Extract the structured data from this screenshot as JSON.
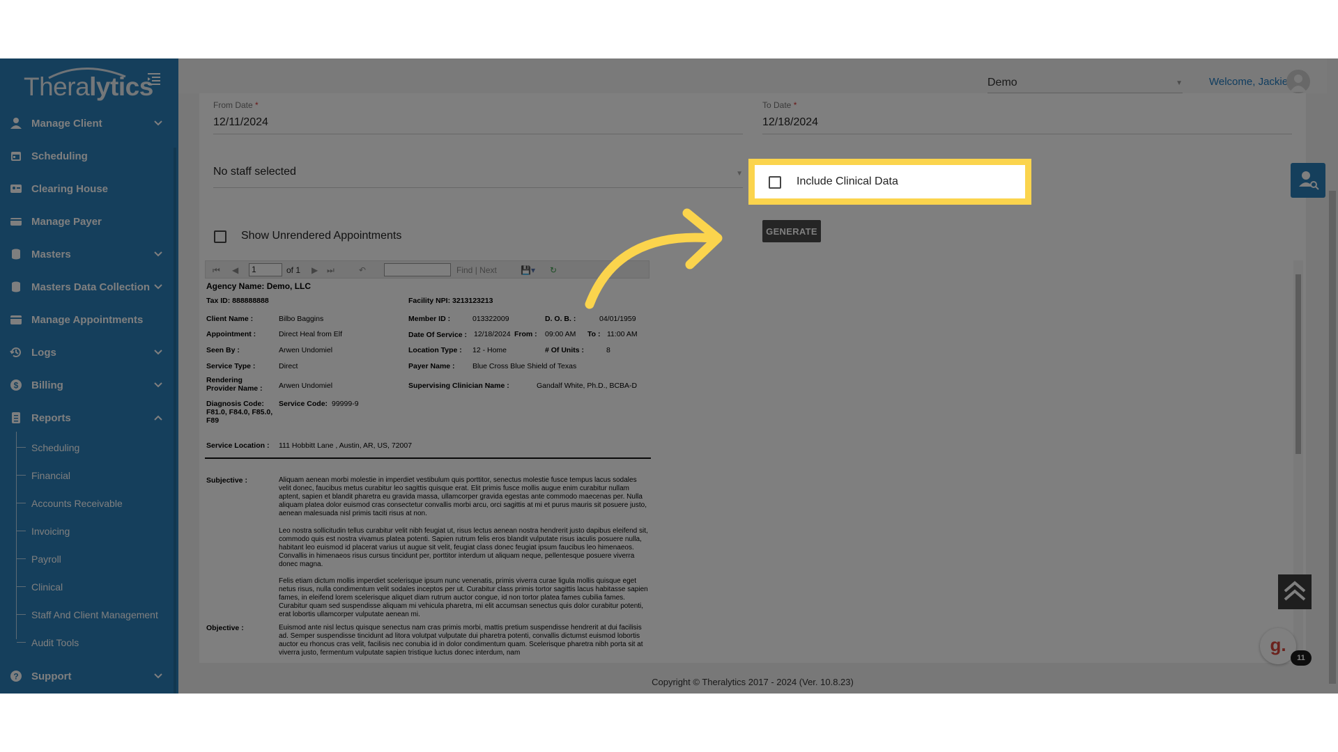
{
  "app": {
    "logo_text_light": "Thera",
    "logo_text_bold": "lytics",
    "welcome": "Welcome, Jackie",
    "organization": "Demo",
    "accent_color": "#2a7fb8",
    "highlight_color": "#fbd44d"
  },
  "sidebar": {
    "items": [
      {
        "label": "Manage Client",
        "icon": "user-icon",
        "has_chevron": true
      },
      {
        "label": "Scheduling",
        "icon": "calendar-icon",
        "has_chevron": false
      },
      {
        "label": "Clearing House",
        "icon": "id-card-icon",
        "has_chevron": false
      },
      {
        "label": "Manage Payer",
        "icon": "wallet-icon",
        "has_chevron": false
      },
      {
        "label": "Masters",
        "icon": "database-icon",
        "has_chevron": true
      },
      {
        "label": "Masters Data Collection",
        "icon": "database-icon",
        "has_chevron": true
      },
      {
        "label": "Manage Appointments",
        "icon": "calendar-alt-icon",
        "has_chevron": false
      },
      {
        "label": "Logs",
        "icon": "history-icon",
        "has_chevron": true
      },
      {
        "label": "Billing",
        "icon": "dollar-icon",
        "has_chevron": true
      },
      {
        "label": "Reports",
        "icon": "report-icon",
        "has_chevron": true,
        "expanded": true
      }
    ],
    "report_subitems": [
      "Scheduling",
      "Financial",
      "Accounts Receivable",
      "Invoicing",
      "Payroll",
      "Clinical",
      "Staff And Client Management",
      "Audit Tools"
    ],
    "support": {
      "label": "Support",
      "icon": "question-icon"
    }
  },
  "form": {
    "from_date_label": "From Date",
    "from_date_value": "12/11/2024",
    "to_date_label": "To Date",
    "to_date_value": "12/18/2024",
    "required_mark": "*",
    "staff_select_value": "No staff selected",
    "show_unrendered_label": "Show Unrendered Appointments",
    "include_clinical_label": "Include Clinical Data",
    "generate_label": "GENERATE"
  },
  "viewer": {
    "page_value": "1",
    "page_of": "of 1",
    "find_label": "Find",
    "separator": "|",
    "next_label": "Next"
  },
  "report": {
    "agency": "Agency Name: Demo, LLC",
    "tax_id": "Tax ID: 888888888",
    "facility_npi": "Facility NPI: 3213123213",
    "client_name_label": "Client Name :",
    "client_name": "Bilbo Baggins",
    "member_id_label": "Member ID :",
    "member_id": "013322009",
    "dob_label": "D. O. B. :",
    "dob": "04/01/1959",
    "appointment_label": "Appointment :",
    "appointment": "Direct Heal from Elf",
    "dos_label": "Date Of Service :",
    "dos": "12/18/2024",
    "from_label": "From :",
    "from": "09:00 AM",
    "to_label": "To :",
    "to": "11:00 AM",
    "seen_by_label": "Seen By :",
    "seen_by": "Arwen Undomiel",
    "location_type_label": "Location Type :",
    "location_type": "12 - Home",
    "units_label": "# Of Units :",
    "units": "8",
    "service_type_label": "Service Type :",
    "service_type": "Direct",
    "payer_label": "Payer Name :",
    "payer": "Blue Cross Blue Shield of Texas",
    "rendering_label_1": "Rendering",
    "rendering_label_2": "Provider Name :",
    "rendering": "Arwen Undomiel",
    "supervising_label": "Supervising Clinician Name :",
    "supervising": "Gandalf White, Ph.D., BCBA-D",
    "diagnosis_label": "Diagnosis Code:",
    "diagnosis_1": "F81.0, F84.0, F85.0,",
    "diagnosis_2": "F89",
    "service_code_label": "Service Code:",
    "service_code": "99999-9",
    "service_location_label": "Service Location :",
    "service_location": "111 Hobbitt Lane , Austin, AR, US, 72007",
    "subjective_label": "Subjective :",
    "subjective_p1": "Aliquam aenean morbi molestie in imperdiet vestibulum quis porttitor, senectus molestie fusce tempus lacus sodales velit donec, faucibus metus curabitur leo sagittis quisque erat. Elit primis fusce mollis augue enim curabitur nullam aptent, sapien et blandit pharetra eu gravida massa, ullamcorper gravida egestas ante commodo maecenas per. Nulla aliquam platea dolor euismod cras consectetur convallis morbi arcu, orci sagittis at mi et purus mauris sit posuere justo, aenean malesuada nisl primis taciti risus at non.",
    "subjective_p2": "Leo nostra sollicitudin tellus curabitur velit nibh feugiat ut, risus lectus aenean nostra hendrerit justo dapibus eleifend sit, commodo quis est nostra vivamus platea potenti. Sapien rutrum felis eros blandit vulputate risus iaculis posuere nulla, habitant leo euismod id placerat varius ut augue sit velit, feugiat class donec feugiat ipsum faucibus leo himenaeos. Convallis in himenaeos risus cursus tincidunt per, porttitor interdum ut aliquam neque, pellentesque posuere viverra donec magna.",
    "subjective_p3": "Felis etiam dictum mollis imperdiet scelerisque ipsum nunc venenatis, primis viverra curae ligula mollis quisque eget netus risus, nulla condimentum velit sodales inceptos per ut. Curabitur class primis tortor sagittis lacus habitasse sapien fames, in eleifend lorem scelerisque aliquet diam rutrum auctor congue, id non tortor platea fames cubilia fames. Curabitur quam sed suspendisse aliquam mi vehicula pharetra, mi elit accumsan senectus quis dolor curabitur potenti, erat lobortis ullamcorper vulputate aenean mi.",
    "objective_label": "Objective :",
    "objective_p1": "Euismod ante nisl lectus quisque senectus nam cras primis morbi, mattis pretium suspendisse hendrerit at dui facilisis ad. Semper suspendisse tincidunt ad litora volutpat vulputate dui pharetra potenti, convallis dictumst euismod lobortis auctor eu rhoncus cras velit, facilisis nec conubia id in dolor condimentum quam. Scelerisque pharetra nibh porta sit at viverra justo, fermentum vulputate sapien tristique luctus donec interdum, nam"
  },
  "footer": {
    "copyright": "Copyright © Theralytics 2017 - 2024 (Ver. 10.8.23)"
  },
  "chat": {
    "logo_letter": "g.",
    "badge_count": "11"
  }
}
